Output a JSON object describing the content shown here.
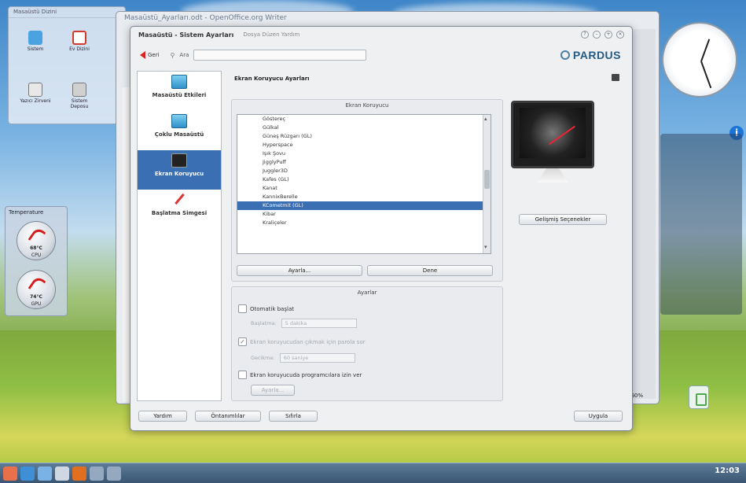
{
  "desktop": {
    "folderview_title": "Masaüstü Dizini",
    "icons": [
      {
        "label": "Sistem",
        "color": "#4aa3e0"
      },
      {
        "label": "Ev Dizini",
        "color": "#d33b2f"
      },
      {
        "label": "Yazıcı Zirveni",
        "color": "#e8e8e8"
      },
      {
        "label": "Sistem Deposu",
        "color": "#d0d0d0"
      }
    ],
    "temp_widget": {
      "title": "Temperature",
      "gauges": [
        {
          "value": "68°C",
          "label": "CPU"
        },
        {
          "value": "74°C",
          "label": "GPU"
        }
      ]
    },
    "watermark": "Pardus",
    "taskbar_clock": "12:03"
  },
  "outer_window": {
    "title": "Masaüstü_Ayarları.odt - OpenOffice.org Writer",
    "zoom": "160%"
  },
  "window": {
    "title": "Masaüstü - Sistem Ayarları",
    "menu": "Dosya Düzen Yardım",
    "toolbar": {
      "back_label": "Geri",
      "search_label": "Ara",
      "search_value": ""
    },
    "logo_text": "PARDUS",
    "sidebar": [
      {
        "label": "Masaüstü Etkileri",
        "icon": "monitor-icon"
      },
      {
        "label": "Çoklu Masaüstü",
        "icon": "monitor-icon"
      },
      {
        "label": "Ekran Koruyucu",
        "icon": "monitor-dark-icon"
      },
      {
        "label": "Başlatma Simgesi",
        "icon": "brush-icon"
      }
    ],
    "active_sidebar_index": 2,
    "section_title": "Ekran Koruyucu Ayarları",
    "screensaver_group": {
      "title": "Ekran Koruyucu",
      "items": [
        "Göstereç",
        "Gülkal",
        "Güneş Rüzgarı (GL)",
        "Hyperspace",
        "Işık Şovu",
        "JigglyPuff",
        "Juggler3D",
        "Kafes (GL)",
        "Kanat",
        "KannixBerelle",
        "KCometmit (GL)",
        "Kibar",
        "Kraliçeler"
      ],
      "selected_index": 10,
      "setup_button": "Ayarla...",
      "test_button": "Dene"
    },
    "advanced_button": "Gelişmiş Seçenekler",
    "settings_group": {
      "title": "Ayarlar",
      "auto_start_label": "Otomatik başlat",
      "after_label": "Başlatma:",
      "after_value": "5 dakika",
      "require_password_label": "Ekran koruyucudan çıkmak için parola sor",
      "password_after_label": "Gecikme:",
      "password_after_value": "60 saniye",
      "allow_programs_label": "Ekran koruyucuda programcılara izin ver",
      "program_setup_button": "Ayarla..."
    },
    "bottom_buttons": {
      "help": "Yardım",
      "defaults": "Öntanımlılar",
      "reset": "Sıfırla",
      "apply": "Uygula"
    }
  }
}
